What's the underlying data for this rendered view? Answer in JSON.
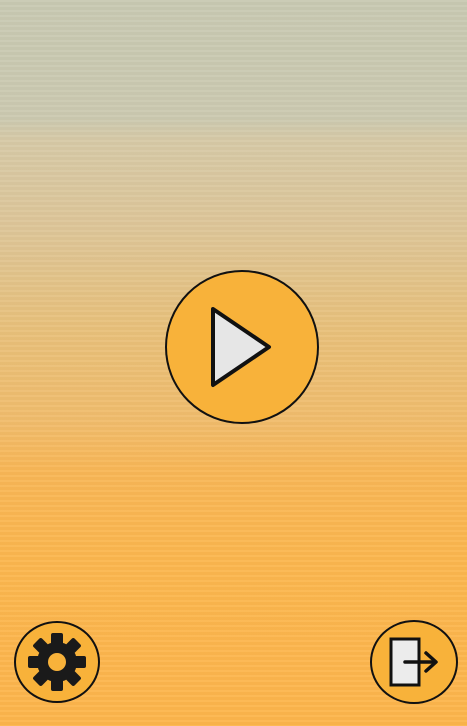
{
  "screen": {
    "name": "main-menu"
  },
  "buttons": {
    "play": {
      "icon": "play-icon"
    },
    "settings": {
      "icon": "gear-icon"
    },
    "exit": {
      "icon": "exit-icon"
    }
  },
  "colors": {
    "button_fill": "#f8b23a",
    "outline": "#111111",
    "play_triangle": "#e6e6e6",
    "background_top": "#c8c9b2",
    "background_bottom": "#fcb54c"
  }
}
